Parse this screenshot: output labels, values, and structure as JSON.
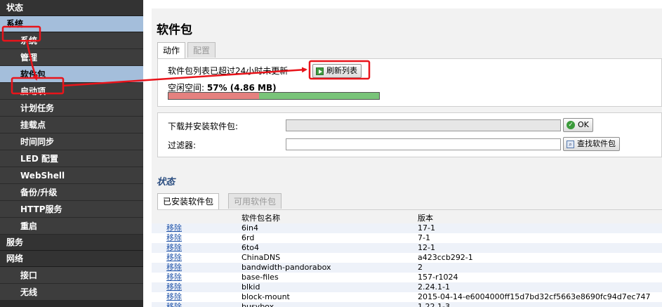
{
  "sidebar": {
    "status": "状态",
    "system": "系统",
    "system_items": [
      "系统",
      "管理",
      "软件包",
      "启动项",
      "计划任务",
      "挂载点",
      "时间同步",
      "LED 配置",
      "WebShell",
      "备份/升级",
      "HTTP服务",
      "重启"
    ],
    "services": "服务",
    "network": "网络",
    "network_items": [
      "接口",
      "无线"
    ]
  },
  "page": {
    "title": "软件包",
    "tabs": [
      "动作",
      "配置"
    ]
  },
  "actions": {
    "notice": "软件包列表已超过24小时未更新",
    "refresh_label": "刷新列表",
    "free_label": "空闲空间: ",
    "free_value": "57% (4.86 MB)",
    "used_fraction": 0.43,
    "install_label": "下载并安装软件包:",
    "ok_label": "OK",
    "filter_label": "过滤器:",
    "find_label": "查找软件包"
  },
  "status": {
    "title": "状态",
    "tabs": [
      "已安装软件包",
      "可用软件包"
    ]
  },
  "packages": {
    "col_name": "软件包名称",
    "col_version": "版本",
    "remove_label": "移除",
    "rows": [
      {
        "name": "6in4",
        "version": "17-1"
      },
      {
        "name": "6rd",
        "version": "7-1"
      },
      {
        "name": "6to4",
        "version": "12-1"
      },
      {
        "name": "ChinaDNS",
        "version": "a423ccb292-1"
      },
      {
        "name": "bandwidth-pandorabox",
        "version": "2"
      },
      {
        "name": "base-files",
        "version": "157-r1024"
      },
      {
        "name": "blkid",
        "version": "2.24.1-1"
      },
      {
        "name": "block-mount",
        "version": "2015-04-14-e6004000ff15d7bd32cf5663e8690fc94d7ec747"
      },
      {
        "name": "busybox",
        "version": "1.22.1-3"
      }
    ]
  },
  "colors": {
    "sidebar_bg": "#2b2b2b",
    "active_bg": "#a4bedb",
    "annotation": "#e8141b",
    "used_bar": "#e5817f",
    "free_bar": "#79c479"
  }
}
